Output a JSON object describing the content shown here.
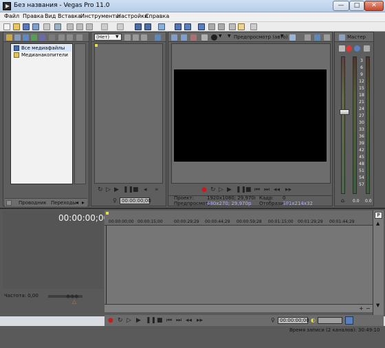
{
  "window": {
    "title": "Без названия - Vegas Pro 11.0",
    "minimize": "—",
    "maximize": "□",
    "close": "✕"
  },
  "menu": [
    "Файл",
    "Правка",
    "Вид",
    "Вставка",
    "Инструменты",
    "Настройки",
    "Справка"
  ],
  "explorer": {
    "tree": [
      "Все медиафайлы",
      "Медианакопители"
    ],
    "tabs": [
      "Проводник",
      "Переходы"
    ]
  },
  "trimmer": {
    "dropdown": "(Нет)",
    "time": "00:00:00;00"
  },
  "preview": {
    "mode": "Предпросмотр (авто)",
    "project_label": "Проект:",
    "project_value": "1920x1080; 29,970i",
    "preview_label": "Предпросмотр:",
    "preview_value": "480x270; 29,970p",
    "frame_label": "Кадр:",
    "frame_value": "0",
    "display_label": "Отобразить:",
    "display_value": "381x214x32"
  },
  "master": {
    "title": "Мастер",
    "scale": [
      "3",
      "6",
      "9",
      "12",
      "15",
      "18",
      "21",
      "24",
      "27",
      "30",
      "33",
      "36",
      "39",
      "42",
      "45",
      "48",
      "51",
      "54",
      "57"
    ],
    "bottom_left": "0.0",
    "bottom_right": "0.0"
  },
  "timeline": {
    "time": "00:00:00;00",
    "ruler": [
      "00:00:00;00",
      "00:00:15;00",
      "00:00:29;29",
      "00:00:44;29",
      "00:00:59;28",
      "00:01:15;00",
      "00:01:29;29",
      "00:01:44;29"
    ],
    "rate_label": "Частота: 0,00",
    "transport_time": "00:00:00;00"
  },
  "status": {
    "text": "Время записи (2 каналов): 30:49:10"
  }
}
